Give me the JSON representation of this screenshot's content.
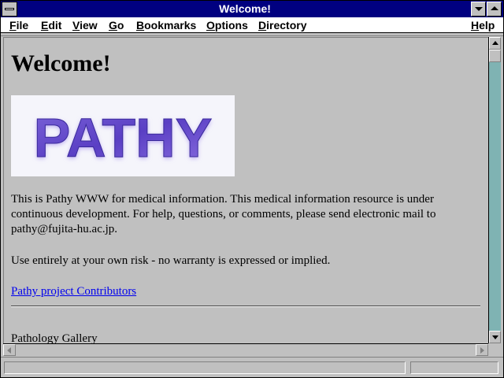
{
  "window": {
    "title": "Welcome!",
    "titlebar_color": "#000080"
  },
  "menubar": {
    "items": [
      {
        "label": "File"
      },
      {
        "label": "Edit"
      },
      {
        "label": "View"
      },
      {
        "label": "Go"
      },
      {
        "label": "Bookmarks"
      },
      {
        "label": "Options"
      },
      {
        "label": "Directory"
      },
      {
        "label": "Help"
      }
    ]
  },
  "page": {
    "heading": "Welcome!",
    "logo_text": "PATHY",
    "paragraph1": "This is Pathy WWW for medical information. This medical information resource is under continuous development. For help, questions, or comments, please send electronic mail to pathy@fujita-hu.ac.jp.",
    "paragraph2": "Use entirely at your own risk - no warranty is expressed or implied.",
    "contributors_link": "Pathy project Contributors",
    "gallery_text": "Pathology Gallery",
    "link_color": "#0000ee"
  },
  "statusbar": {
    "text": ""
  },
  "icons": {
    "system_menu": "system-menu-icon",
    "minimize": "minimize-icon",
    "maximize": "maximize-icon",
    "scroll_up": "scroll-up-icon",
    "scroll_down": "scroll-down-icon",
    "scroll_left": "scroll-left-icon",
    "scroll_right": "scroll-right-icon"
  }
}
